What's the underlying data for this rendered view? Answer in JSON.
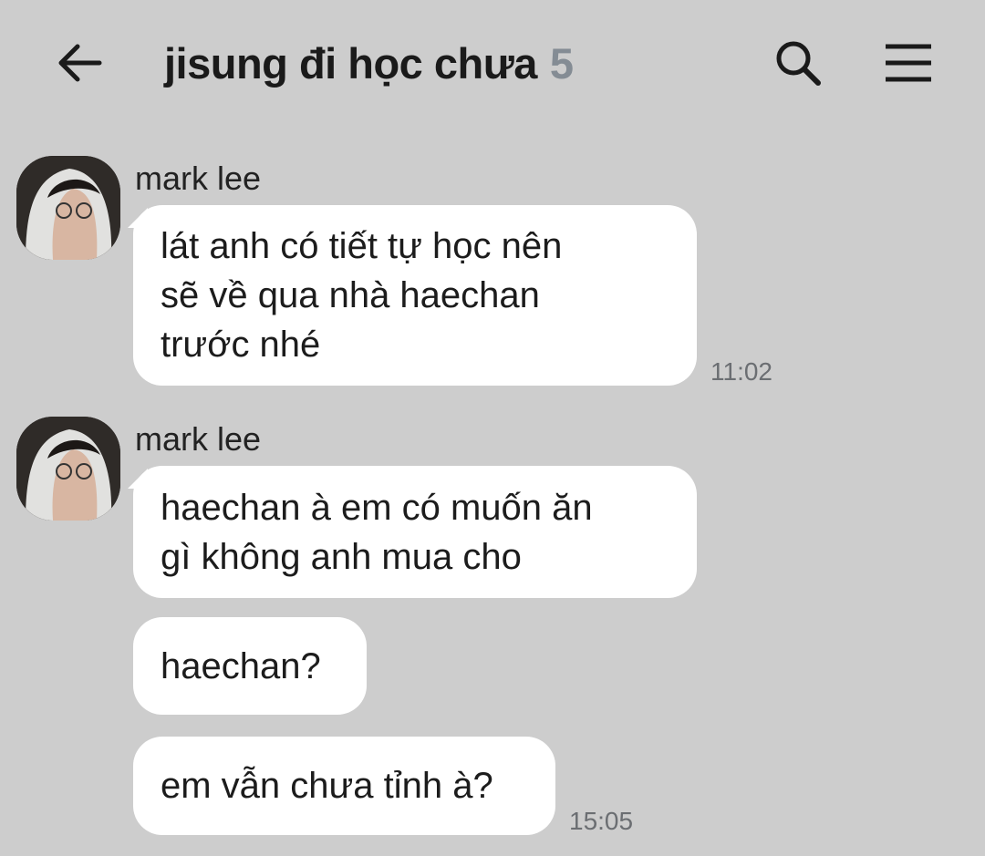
{
  "header": {
    "title": "jisung đi học chưa",
    "member_count": "5",
    "back_icon": "arrow-left-icon",
    "search_icon": "search-icon",
    "menu_icon": "hamburger-menu-icon"
  },
  "messages": [
    {
      "sender": "mark lee",
      "bubbles": [
        "lát anh có tiết tự học nên\nsẽ về qua nhà haechan\ntrước nhé"
      ],
      "time": "11:02"
    },
    {
      "sender": "mark lee",
      "bubbles": [
        "haechan à em có muốn ăn\ngì không anh mua cho",
        "haechan?",
        "em vẫn chưa tỉnh à?"
      ],
      "time": "15:05"
    }
  ],
  "colors": {
    "background": "#cdcdcd",
    "bubble": "#ffffff",
    "count": "#848c94",
    "timestamp": "#6b6e72"
  }
}
